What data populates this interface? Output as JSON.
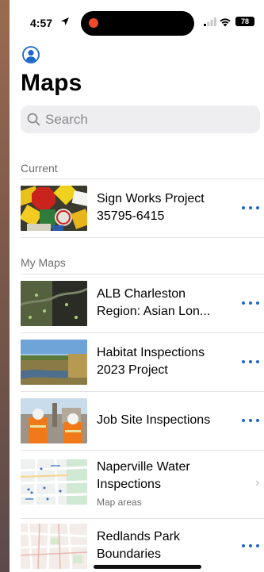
{
  "status": {
    "time": "4:57",
    "battery": "78"
  },
  "header": {
    "title": "Maps"
  },
  "search": {
    "placeholder": "Search"
  },
  "sections": {
    "current": "Current",
    "my_maps": "My Maps"
  },
  "current_item": {
    "title_line1": "Sign Works Project",
    "title_line2": "35795-6415"
  },
  "my_maps": [
    {
      "title_line1": "ALB Charleston",
      "title_line2": "Region: Asian Lon..."
    },
    {
      "title_line1": "Habitat Inspections",
      "title_line2": "2023 Project"
    },
    {
      "title_line1": "Job Site Inspections"
    },
    {
      "title_line1": "Naperville Water",
      "title_line2": "Inspections",
      "subtitle": "Map areas"
    },
    {
      "title_line1": "Redlands Park",
      "title_line2": "Boundaries"
    }
  ],
  "colors": {
    "accent": "#1e66c9",
    "background": "#ffffff",
    "secondary_text": "#6d6d72"
  },
  "icons": [
    "location-arrow-icon",
    "signal-icon",
    "wifi-icon",
    "battery-icon",
    "profile-icon",
    "search-icon",
    "more-icon",
    "chevron-right-icon"
  ]
}
